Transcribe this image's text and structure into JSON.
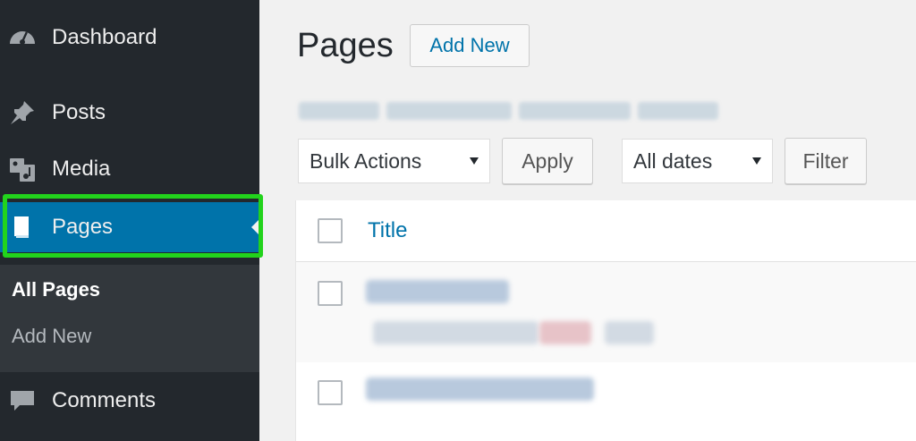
{
  "sidebar": {
    "items": [
      {
        "label": "Dashboard",
        "icon": "dashboard-icon"
      },
      {
        "label": "Posts",
        "icon": "pin-icon"
      },
      {
        "label": "Media",
        "icon": "media-icon"
      },
      {
        "label": "Pages",
        "icon": "page-icon"
      },
      {
        "label": "Comments",
        "icon": "comment-icon"
      }
    ],
    "submenu": [
      {
        "label": "All Pages"
      },
      {
        "label": "Add New"
      }
    ]
  },
  "header": {
    "title": "Pages",
    "add_new_label": "Add New"
  },
  "filters": {
    "bulk_actions": "Bulk Actions",
    "apply_label": "Apply",
    "dates": "All dates",
    "filter_label": "Filter"
  },
  "table": {
    "title_column": "Title"
  },
  "colors": {
    "sidebar_bg": "#23282d",
    "active_bg": "#0073aa",
    "highlight_border": "#22d31c",
    "link": "#0073aa"
  }
}
